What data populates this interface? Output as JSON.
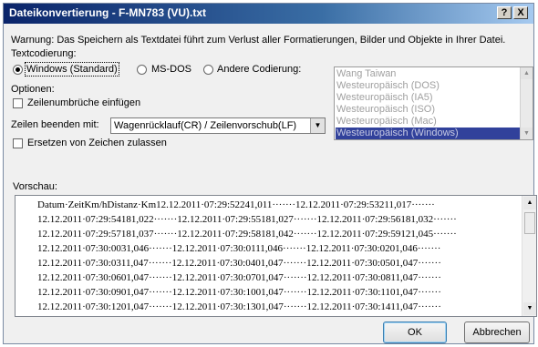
{
  "window": {
    "title": "Dateikonvertierung - F-MN783 (VU).txt",
    "help_glyph": "?",
    "close_glyph": "X"
  },
  "warning_text": "Warnung: Das Speichern als Textdatei führt zum Verlust aller Formatierungen, Bilder und Objekte in Ihrer Datei.",
  "encoding": {
    "group_label": "Textcodierung:",
    "options": [
      {
        "label": "Windows (Standard)",
        "selected": true
      },
      {
        "label": "MS-DOS",
        "selected": false
      },
      {
        "label": "Andere Codierung:",
        "selected": false
      }
    ],
    "list_items": [
      {
        "label": "Wang Taiwan",
        "selected": false
      },
      {
        "label": "Westeuropäisch (DOS)",
        "selected": false
      },
      {
        "label": "Westeuropäisch (IA5)",
        "selected": false
      },
      {
        "label": "Westeuropäisch (ISO)",
        "selected": false
      },
      {
        "label": "Westeuropäisch (Mac)",
        "selected": false
      },
      {
        "label": "Westeuropäisch (Windows)",
        "selected": true
      }
    ]
  },
  "options": {
    "group_label": "Optionen:",
    "insert_line_breaks": {
      "label": "Zeilenumbrüche einfügen",
      "checked": false
    },
    "end_lines": {
      "label": "Zeilen beenden mit:",
      "value": "Wagenrücklauf(CR) / Zeilenvorschub(LF)"
    },
    "allow_substitution": {
      "label": "Ersetzen von Zeichen zulassen",
      "checked": false
    }
  },
  "preview": {
    "label": "Vorschau:",
    "lines": [
      "Datum·ZeitKm/hDistanz·Km12.12.2011·07:29:52241,011·······12.12.2011·07:29:53211,017·······",
      "12.12.2011·07:29:54181,022·······12.12.2011·07:29:55181,027·······12.12.2011·07:29:56181,032·······",
      "12.12.2011·07:29:57181,037·······12.12.2011·07:29:58181,042·······12.12.2011·07:29:59121,045·······",
      "12.12.2011·07:30:0031,046·······12.12.2011·07:30:0111,046·······12.12.2011·07:30:0201,046·······",
      "12.12.2011·07:30:0311,047·······12.12.2011·07:30:0401,047·······12.12.2011·07:30:0501,047·······",
      "12.12.2011·07:30:0601,047·······12.12.2011·07:30:0701,047·······12.12.2011·07:30:0811,047·······",
      "12.12.2011·07:30:0901,047·······12.12.2011·07:30:1001,047·······12.12.2011·07:30:1101,047·······",
      "12.12.2011·07:30:1201,047·······12.12.2011·07:30:1301,047·······12.12.2011·07:30:1411,047·······"
    ]
  },
  "buttons": {
    "ok": "OK",
    "cancel": "Abbrechen"
  },
  "icons": {
    "scroll_up": "up-arrow-icon",
    "scroll_down": "down-arrow-icon",
    "dropdown": "chevron-down-icon"
  },
  "colors": {
    "title_bar_start": "#0a246a",
    "title_bar_end": "#a6caf0",
    "list_selection": "#31419b",
    "dialog_bg": "#f0f0f0"
  }
}
